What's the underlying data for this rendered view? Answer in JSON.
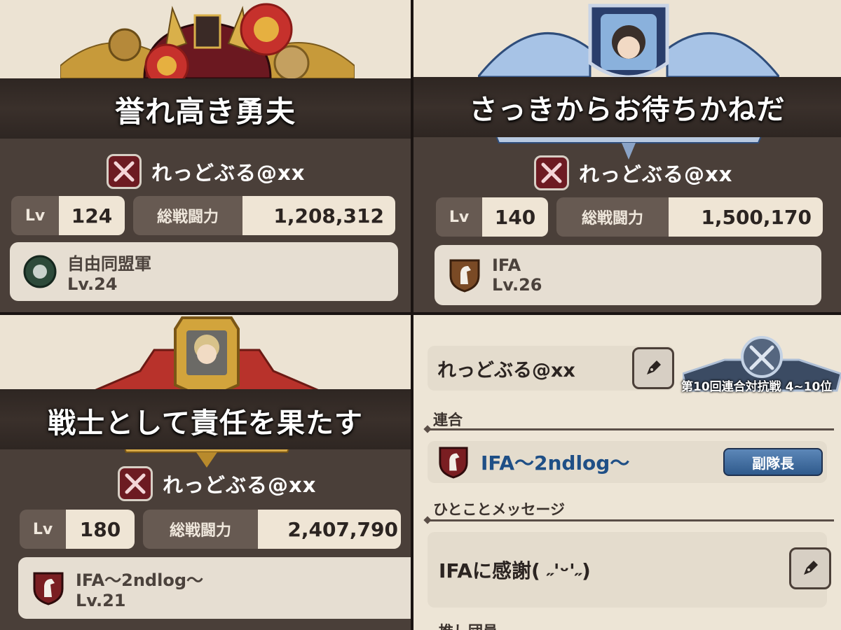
{
  "panels": [
    {
      "title": "誉れ高き勇夫",
      "player_name": "れっどぶる@xx",
      "lv_label": "Lv",
      "lv_value": "124",
      "power_label": "総戦闘力",
      "power_value": "1,208,312",
      "alliance_name": "自由同盟軍",
      "alliance_level": "Lv.24"
    },
    {
      "title": "さっきからお待ちかねだ",
      "player_name": "れっどぶる@xx",
      "lv_label": "Lv",
      "lv_value": "140",
      "power_label": "総戦闘力",
      "power_value": "1,500,170",
      "alliance_name": "IFA",
      "alliance_level": "Lv.26"
    },
    {
      "title": "戦士として責任を果たす",
      "player_name": "れっどぶる@xx",
      "lv_label": "Lv",
      "lv_value": "180",
      "power_label": "総戦闘力",
      "power_value": "2,407,790",
      "alliance_name": "IFA〜2ndlog〜",
      "alliance_level": "Lv.21"
    }
  ],
  "profile": {
    "name": "れっどぶる@xx",
    "rank_caption": "第10回連合対抗戦 4~10位",
    "union_section": "連合",
    "union_name": "IFA〜2ndlog〜",
    "role": "副隊長",
    "message_section": "ひとことメッセージ",
    "message": "IFAに感謝( ˶'ᵕ'˶)",
    "next_section": "推し団員"
  },
  "colors": {
    "card_dark": "#4a3f39",
    "title_band": "#2e2622",
    "rank_red": "#6d1b22",
    "union_blue": "#1f4f86",
    "role_badge": "#2f5a8c"
  }
}
